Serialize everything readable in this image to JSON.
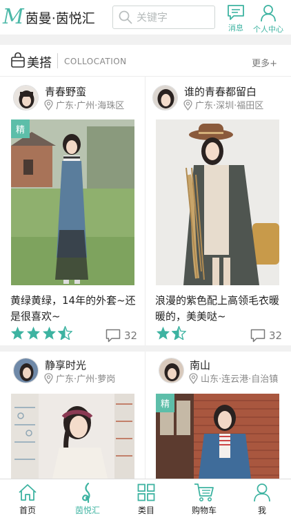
{
  "header": {
    "logo_m": "M",
    "logo_text": "茵曼·茵悦汇",
    "search_placeholder": "关键字",
    "messages_label": "消息",
    "profile_label": "个人中心"
  },
  "section": {
    "title": "美搭",
    "subtitle": "COLLOCATION",
    "more_label": "更多+"
  },
  "cards": [
    {
      "user": "青春野蛮",
      "location": "广东·广州·海珠区",
      "badge": "精",
      "caption": "黄绿黄绿，14年的外套~还是很喜欢~",
      "rating": 3.5,
      "comments": "32"
    },
    {
      "user": "谁的青春都留白",
      "location": "广东·深圳·福田区",
      "badge": "",
      "caption": "浪漫的紫色配上高领毛衣暖暖的，美美哒~",
      "rating": 1.5,
      "comments": "32"
    },
    {
      "user": "静享时光",
      "location": "广东·广州·萝岗",
      "badge": ""
    },
    {
      "user": "南山",
      "location": "山东·连云港·自治镇",
      "badge": "精"
    }
  ],
  "nav": {
    "items": [
      {
        "label": "首页",
        "icon": "home-icon",
        "active": false
      },
      {
        "label": "茵悦汇",
        "icon": "note-icon",
        "active": true
      },
      {
        "label": "类目",
        "icon": "grid-icon",
        "active": false
      },
      {
        "label": "购物车",
        "icon": "cart-icon",
        "active": false
      },
      {
        "label": "我",
        "icon": "person-icon",
        "active": false
      }
    ]
  },
  "colors": {
    "accent": "#3db3a1",
    "badge": "#5dbea9",
    "divider": "#ececec"
  }
}
